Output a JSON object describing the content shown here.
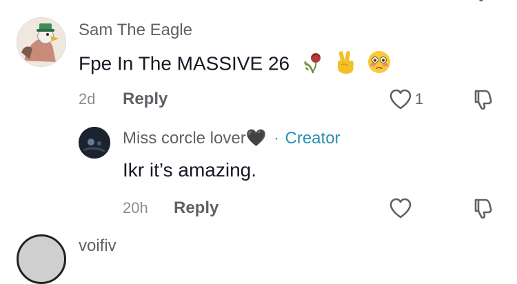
{
  "comments": [
    {
      "username": "Sam The Eagle",
      "text": "Fpe In The MASSIVE 26",
      "emojis": [
        "wilted-rose-emoji",
        "victory-hand-emoji",
        "flushed-face-emoji"
      ],
      "time": "2d",
      "reply_label": "Reply",
      "like_count": "1",
      "avatar": "eagle-avatar"
    }
  ],
  "replies": [
    {
      "username": "Miss corcle lover🖤",
      "badge_separator": "·",
      "badge": "Creator",
      "text": "Ikr it’s amazing.",
      "time": "20h",
      "reply_label": "Reply",
      "avatar": "dark-avatar"
    }
  ],
  "next_comment": {
    "username_partial": "voifiv"
  },
  "colors": {
    "creator_badge": "#2a8fb2",
    "secondary_text": "#8a8b91"
  }
}
